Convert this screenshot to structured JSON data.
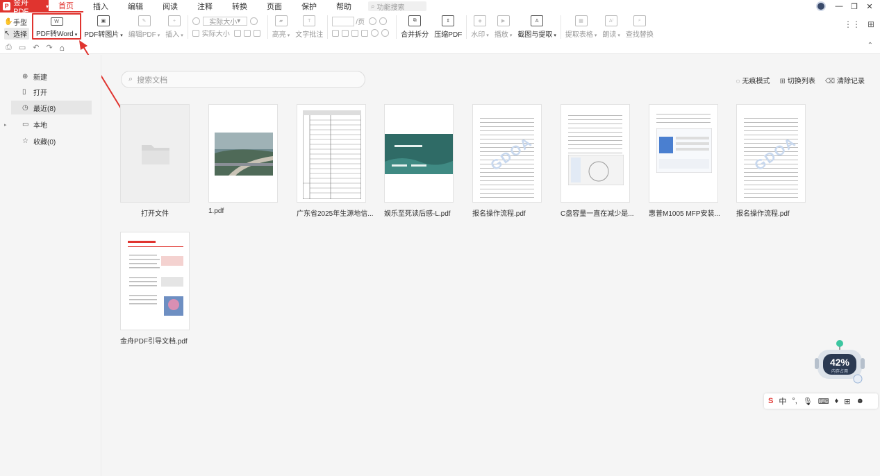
{
  "titlebar": {
    "app_name": "金舟PDF",
    "menus": [
      "首页",
      "插入",
      "编辑",
      "阅读",
      "注释",
      "转换",
      "页面",
      "保护",
      "帮助"
    ],
    "active_menu": "首页",
    "search_placeholder": "功能搜索"
  },
  "ribbon": {
    "hand_label": "手型",
    "select_label": "选择",
    "pdf_to_word": "PDF转Word",
    "pdf_to_image": "PDF转图片",
    "edit_pdf": "编辑PDF",
    "insert": "插入",
    "zoom_value": "实际大小",
    "actual_size": "实际大小",
    "highlight": "高亮",
    "text_comment": "文字批注",
    "page_suffix": "/页",
    "merge_split": "合并拆分",
    "compress": "压缩PDF",
    "watermark": "水印",
    "play": "播放",
    "screenshot_extract": "截图与提取",
    "extract_table": "提取表格",
    "read_aloud": "朗读",
    "find_replace": "查找替换"
  },
  "sidebar": {
    "items": [
      {
        "label": "新建",
        "icon": "new-file-icon"
      },
      {
        "label": "打开",
        "icon": "open-file-icon"
      },
      {
        "label": "最近(8)",
        "icon": "clock-icon"
      },
      {
        "label": "本地",
        "icon": "computer-icon"
      },
      {
        "label": "收藏(0)",
        "icon": "star-icon"
      }
    ]
  },
  "main": {
    "search_placeholder": "搜索文档",
    "links": [
      "无痕模式",
      "切换列表",
      "清除记录"
    ],
    "open_file_label": "打开文件",
    "files": [
      {
        "name": "1.pdf"
      },
      {
        "name": "广东省2025年生源地信..."
      },
      {
        "name": "娱乐至死读后感-L.pdf"
      },
      {
        "name": "报名操作流程.pdf"
      },
      {
        "name": "C盘容量一直在减少是..."
      },
      {
        "name": "惠普M1005 MFP安装..."
      },
      {
        "name": "报名操作流程.pdf"
      },
      {
        "name": "金舟PDF引导文档.pdf"
      }
    ]
  },
  "memory_widget": {
    "percent": "42%",
    "label": "内存占用"
  },
  "ime": {
    "lang": "中"
  },
  "colors": {
    "accent": "#e0342f",
    "teal": "#2f6b66"
  }
}
